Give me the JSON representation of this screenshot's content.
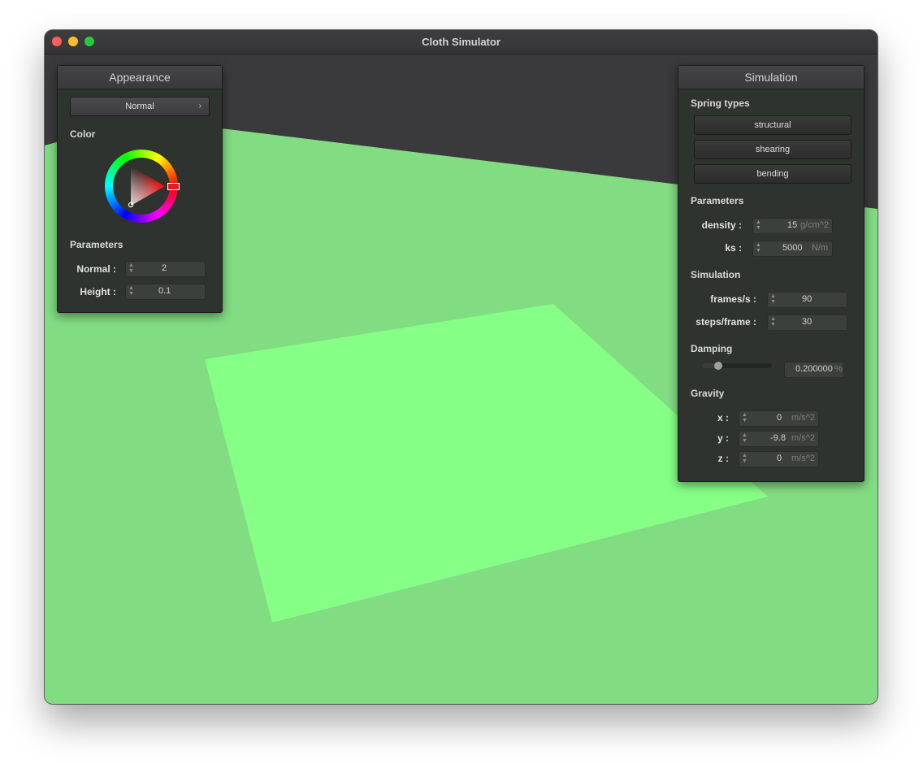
{
  "window": {
    "title": "Cloth Simulator"
  },
  "appearance": {
    "header": "Appearance",
    "shader_dropdown": "Normal",
    "color_label": "Color",
    "selected_color": "#ff0000",
    "parameters_label": "Parameters",
    "normal": {
      "label": "Normal :",
      "value": "2"
    },
    "height": {
      "label": "Height :",
      "value": "0.1"
    }
  },
  "simulation": {
    "header": "Simulation",
    "spring_types_label": "Spring types",
    "spring_buttons": [
      "structural",
      "shearing",
      "bending"
    ],
    "parameters_label": "Parameters",
    "density": {
      "label": "density :",
      "value": "15",
      "unit": "g/cm^2"
    },
    "ks": {
      "label": "ks :",
      "value": "5000",
      "unit": "N/m"
    },
    "simulation_label": "Simulation",
    "frames_per_s": {
      "label": "frames/s :",
      "value": "90"
    },
    "steps_per_frame": {
      "label": "steps/frame :",
      "value": "30"
    },
    "damping_label": "Damping",
    "damping": {
      "value": "0.200000",
      "unit": "%",
      "slider_fraction": 0.2
    },
    "gravity_label": "Gravity",
    "gravity": {
      "x": {
        "label": "x :",
        "value": "0",
        "unit": "m/s^2"
      },
      "y": {
        "label": "y :",
        "value": "-9.8",
        "unit": "m/s^2"
      },
      "z": {
        "label": "z :",
        "value": "0",
        "unit": "m/s^2"
      }
    }
  },
  "colors": {
    "cloth": "#85ff85",
    "floor": "#82dc82",
    "background": "#3a3a3c"
  }
}
